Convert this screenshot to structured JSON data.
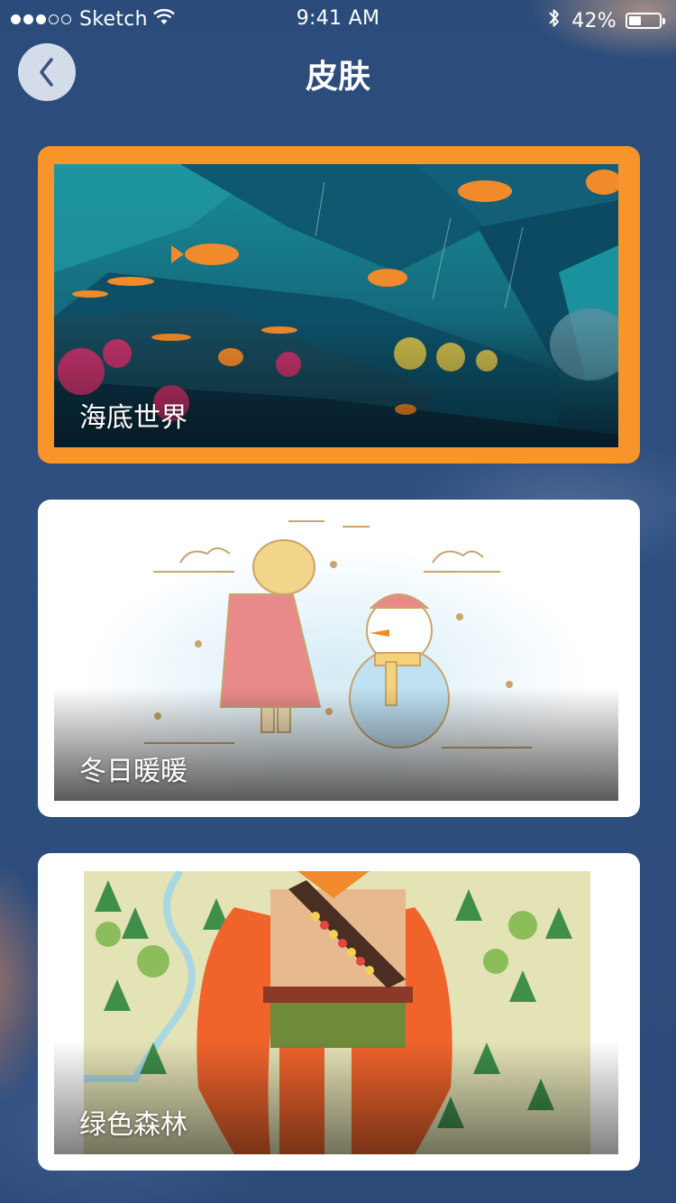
{
  "status_bar": {
    "carrier": "Sketch",
    "time": "9:41 AM",
    "battery_percent": "42%",
    "battery_level": 0.42,
    "signal_dots_filled": 3,
    "signal_dots_total": 5
  },
  "nav": {
    "back_icon": "chevron-left-icon",
    "title": "皮肤"
  },
  "skins": [
    {
      "label": "海底世界",
      "selected": true
    },
    {
      "label": "冬日暖暖",
      "selected": false
    },
    {
      "label": "绿色森林",
      "selected": false
    }
  ],
  "colors": {
    "background": "#2d4d7e",
    "selected_border": "#f7952a",
    "card_border": "#ffffff"
  }
}
